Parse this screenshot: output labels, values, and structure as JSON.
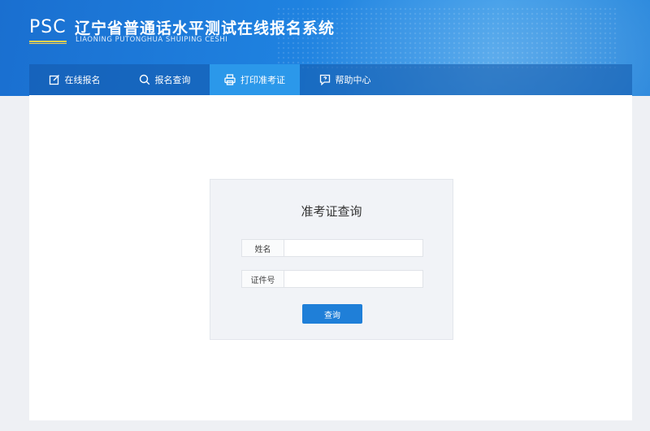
{
  "header": {
    "logo_text": "PSC",
    "title": "辽宁省普通话水平测试在线报名系统",
    "subtitle": "LIAONING PUTONGHUA SHUIPING CESHI"
  },
  "nav": {
    "items": [
      {
        "label": "在线报名",
        "icon": "edit-icon"
      },
      {
        "label": "报名查询",
        "icon": "search-icon"
      },
      {
        "label": "打印准考证",
        "icon": "printer-icon",
        "active": true
      },
      {
        "label": "帮助中心",
        "icon": "help-chat-icon"
      }
    ]
  },
  "query_card": {
    "title": "准考证查询",
    "name_label": "姓名",
    "name_value": "",
    "id_label": "证件号",
    "id_value": "",
    "submit_label": "查询"
  },
  "colors": {
    "header_blue": "#1f82e0",
    "nav_active": "#2b98ea",
    "button_blue": "#1f7fd8",
    "logo_accent": "#ffd34d"
  }
}
